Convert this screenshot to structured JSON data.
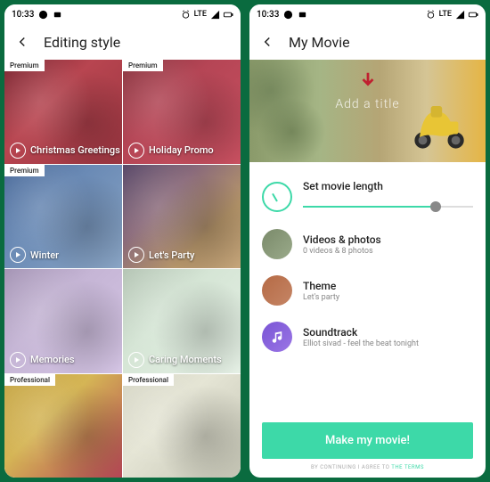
{
  "statusbar": {
    "time": "10:33",
    "network": "LTE"
  },
  "left": {
    "title": "Editing style",
    "tiles": [
      {
        "title": "Christmas Greetings",
        "badge": "Premium"
      },
      {
        "title": "Holiday Promo",
        "badge": "Premium"
      },
      {
        "title": "Winter",
        "badge": "Premium"
      },
      {
        "title": "Let's Party",
        "badge": null
      },
      {
        "title": "Memories",
        "badge": null
      },
      {
        "title": "Caring Moments",
        "badge": null
      },
      {
        "title": "",
        "badge": "Professional"
      },
      {
        "title": "",
        "badge": "Professional"
      }
    ]
  },
  "right": {
    "title": "My Movie",
    "hero_overlay": "Add a title",
    "length": {
      "label": "Set movie length"
    },
    "media": {
      "label": "Videos & photos",
      "sub": "0 videos & 8 photos"
    },
    "theme": {
      "label": "Theme",
      "sub": "Let's party"
    },
    "sound": {
      "label": "Soundtrack",
      "sub": "Elliot sivad - feel the beat tonight"
    },
    "cta": "Make my movie!",
    "terms_prefix": "BY CONTINUING I AGREE TO ",
    "terms_link": "THE TERMS"
  }
}
